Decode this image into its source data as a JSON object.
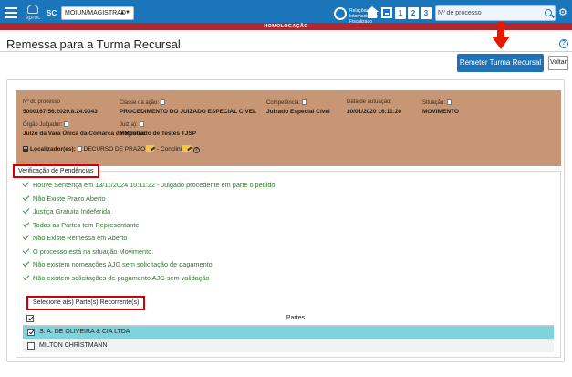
{
  "topbar": {
    "logo_text": "eproc",
    "sc_label": "SC",
    "select_value": "MOIUN/MAGISTRAD",
    "badge_text": "Relações Internacionais Fiscalizado",
    "num_buttons": [
      "1",
      "2",
      "3"
    ],
    "search_placeholder": "Nº de processo",
    "colors": {
      "bar": "#1b75bb"
    }
  },
  "environment_banner": "HOMOLOGAÇÃO",
  "page": {
    "title": "Remessa para a Turma Recursal",
    "help": "?"
  },
  "actions": {
    "remeter_label": "Remeter Turma Recursal",
    "voltar_label": "Voltar"
  },
  "process": {
    "numero_label": "Nº do processo",
    "numero_value": "5000167-56.2020.8.24.0043",
    "classe_label": "Classe da ação:",
    "classe_value": "PROCEDIMENTO DO JUIZADO ESPECIAL CÍVEL",
    "competencia_label": "Competência:",
    "competencia_value": "Juizado Especial Cível",
    "data_label": "Data de autuação:",
    "data_value": "30/01/2020 16:11:20",
    "situacao_label": "Situação:",
    "situacao_value": "MOVIMENTO",
    "orgao_label": "Órgão Julgador:",
    "orgao_value": "Juízo da Vara Única da Comarca de Mondaí",
    "juiz_label": "Juiz(a):",
    "juiz_value": "Magistrado de Testes TJSP",
    "localizador_label": "Localizador(es):",
    "localizador_1": "DECURSO DE PRAZO",
    "localizador_2": "- Conclini",
    "box_color": "#c69675"
  },
  "verificacao": {
    "title": "Verificação de Pendências",
    "items": [
      "Houve Sentença em 13/11/2024 10:11:22 - Julgado procedente em parte o pedido",
      "Não Existe Prazo Aberto",
      "Justiça Gratuita Indeferida",
      "Todas as Partes tem Representante",
      "Não Existe Remessa em Aberto",
      "O processo está na situação Movimento.",
      "Não existem nomeações AJG sem solicitação de pagamento",
      "Não existem solicitações de pagamento AJG sem validação"
    ]
  },
  "partes": {
    "select_label": "Selecione a(s) Parte(s) Recorrente(s)",
    "header": "Partes",
    "rows": [
      {
        "name": "S. A. DE OLIVEIRA & CIA LTDA",
        "checked": true
      },
      {
        "name": "MILTON CHRISTMANN",
        "checked": false
      }
    ],
    "selected_color": "#7fd3dd"
  }
}
